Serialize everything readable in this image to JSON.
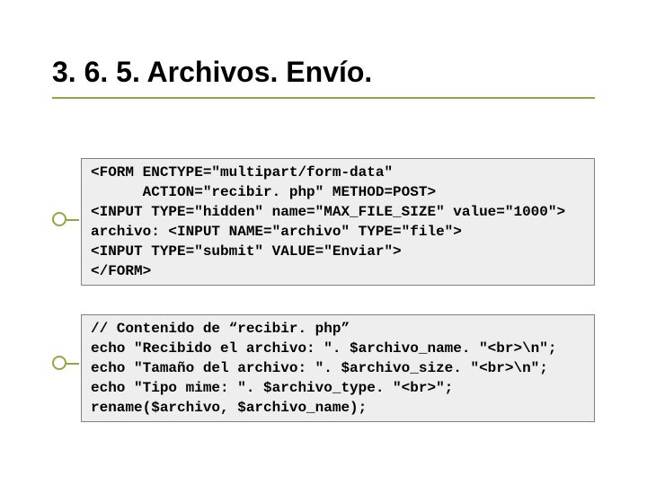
{
  "title": "3. 6. 5. Archivos. Envío.",
  "code1": {
    "l1": "<FORM ENCTYPE=\"multipart/form-data\"",
    "l2": "      ACTION=\"recibir. php\" METHOD=POST>",
    "l3": "<INPUT TYPE=\"hidden\" name=\"MAX_FILE_SIZE\" value=\"1000\">",
    "l4": "archivo: <INPUT NAME=\"archivo\" TYPE=\"file\">",
    "l5": "<INPUT TYPE=\"submit\" VALUE=\"Enviar\">",
    "l6": "</FORM>"
  },
  "code2": {
    "l1": "// Contenido de “recibir. php”",
    "l2": "echo \"Recibido el archivo: \". $archivo_name. \"<br>\\n\";",
    "l3": "echo \"Tamaño del archivo: \". $archivo_size. \"<br>\\n\";",
    "l4": "echo \"Tipo mime: \". $archivo_type. \"<br>\";",
    "l5": "rename($archivo, $archivo_name);"
  }
}
